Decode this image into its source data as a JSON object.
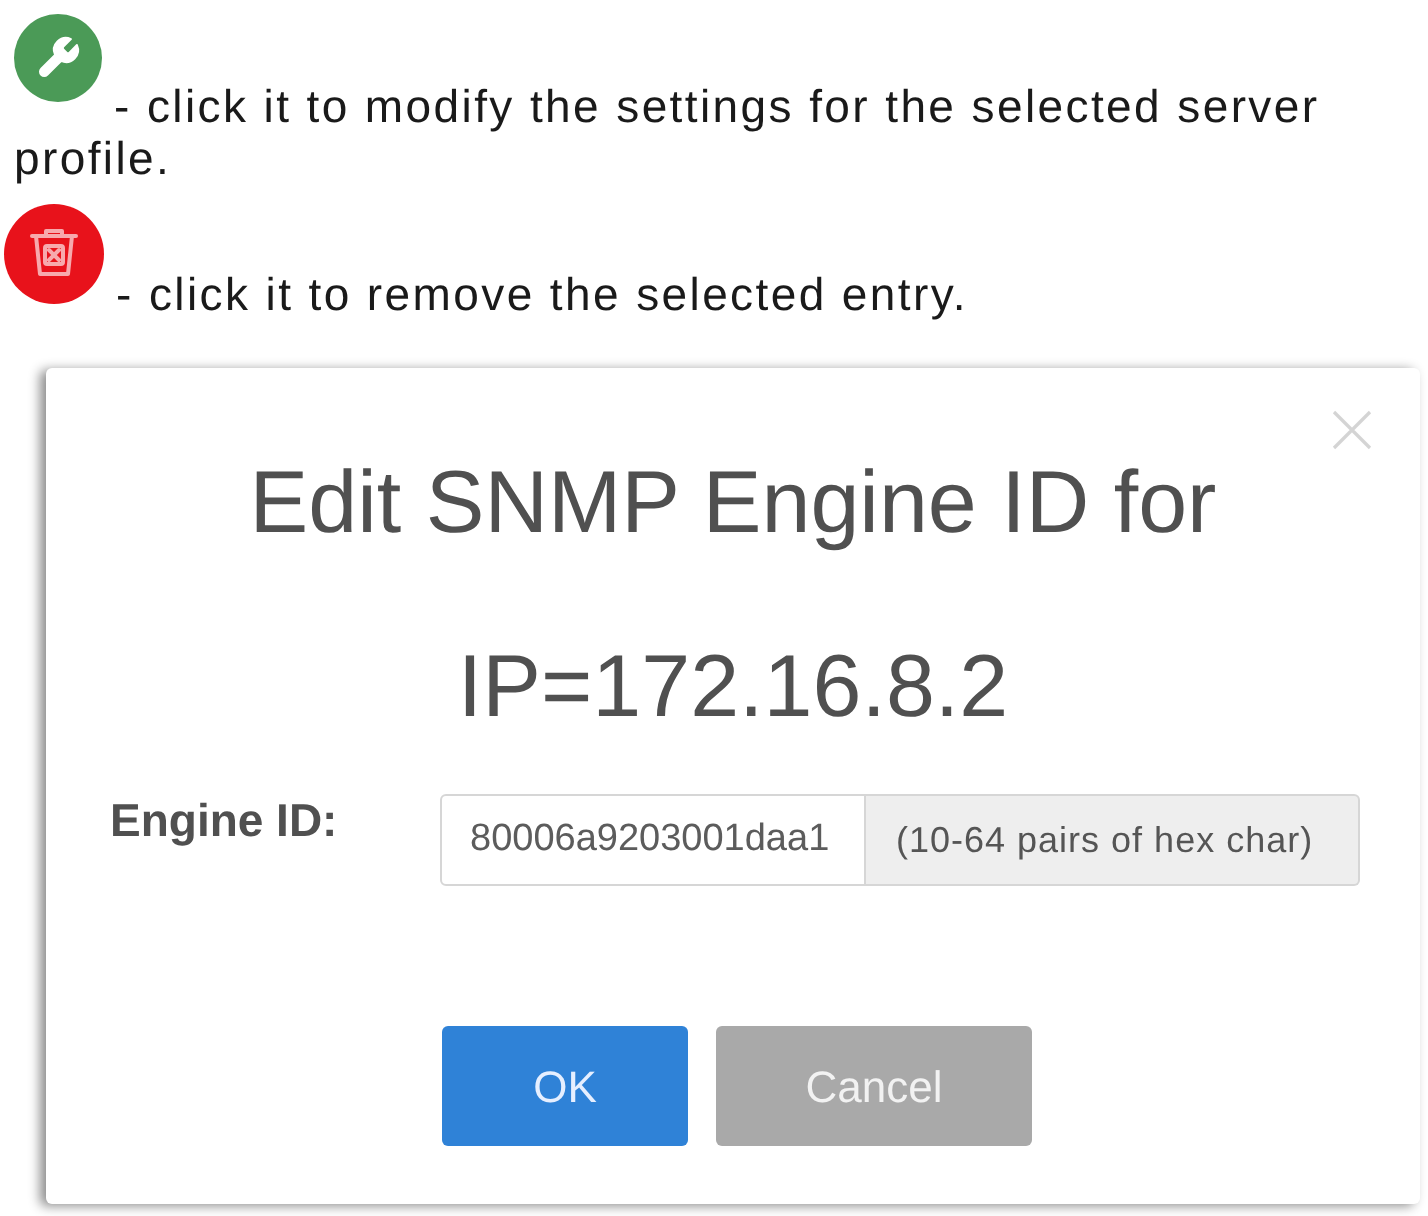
{
  "help_items": [
    {
      "kind": "edit",
      "text": "- click it to modify the settings for the selected server profile."
    },
    {
      "kind": "delete",
      "text": "- click it to remove the selected entry."
    }
  ],
  "dialog": {
    "title": "Edit SNMP Engine ID for IP=172.16.8.2",
    "field": {
      "label": "Engine ID:",
      "value": "80006a9203001daa1",
      "hint": "(10-64 pairs of hex char)"
    },
    "buttons": [
      {
        "label": "OK",
        "kind": "primary"
      },
      {
        "label": "Cancel",
        "kind": "secondary"
      }
    ]
  }
}
